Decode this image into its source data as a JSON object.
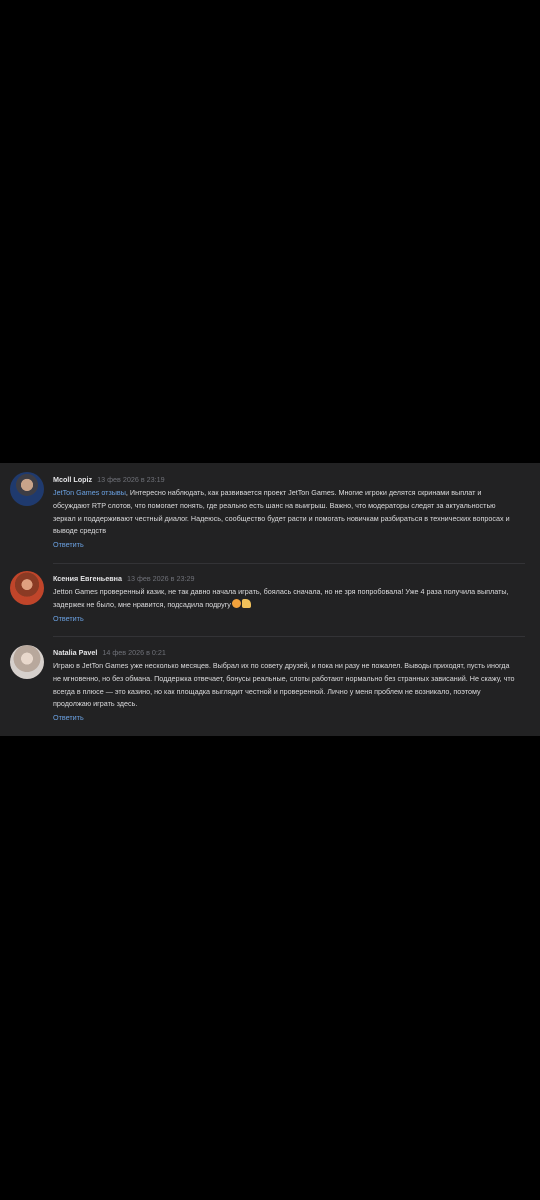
{
  "comments": [
    {
      "author": "Mcoll Lopiz",
      "date": "13 фев 2026 в 23:19",
      "link_text": "JetTon Games отзывы",
      "text": ", Интересно наблюдать, как развивается проект JetTon Games. Многие игроки делятся скринами выплат и обсуждают RTP слотов, что помогает понять, где реально есть шанс на выигрыш. Важно, что модераторы следят за актуальностью зеркал и поддерживают честный диалог. Надеюсь, сообщество будет расти и помогать новичкам разбираться в технических вопросах и выводе средств",
      "reply": "Ответить"
    },
    {
      "author": "Ксения Евгеньевна",
      "date": "13 фев 2026 в 23:29",
      "text": "Jetton Games проверенный казик, не так давно начала играть, боялась сначала, но не зря попробовала! Уже 4 раза получила выплаты, задержек не было, мне нравится, подсадила подругу",
      "emoji": [
        "smiling-face-icon",
        "thumbs-up-icon"
      ],
      "reply": "Ответить"
    },
    {
      "author": "Natalia Pavel",
      "date": "14 фев 2026 в 0:21",
      "text": "Играю в JetTon Games уже несколько месяцев. Выбрал их по совету друзей, и пока ни разу не пожалел. Выводы приходят, пусть иногда не мгновенно, но без обмана. Поддержка отвечает, бонусы реальные, слоты работают нормально без странных зависаний. Не скажу, что всегда в плюсе — это казино, но как площадка выглядит честной и проверенной. Лично у меня проблем не возникало, поэтому продолжаю играть здесь.",
      "reply": "Ответить"
    }
  ],
  "colors": {
    "background": "#000000",
    "panel": "#222223",
    "link": "#6ba2e3",
    "author": "#e4e4e6",
    "date": "#6f7178",
    "text": "#dcdcde"
  }
}
